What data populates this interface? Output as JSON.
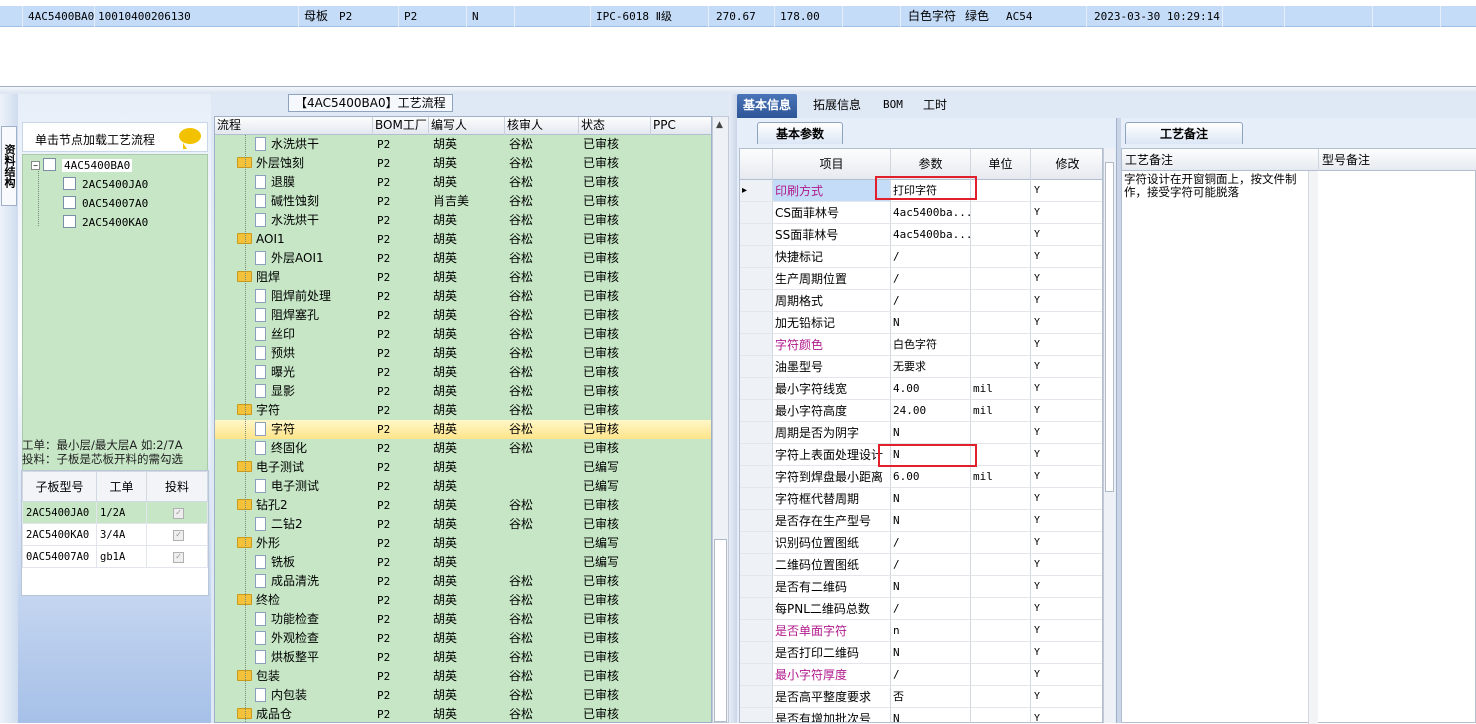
{
  "top_record": {
    "cells": [
      "4AC5400BA0",
      "10010400206130",
      "母板",
      "P2",
      "P2",
      "N",
      "IPC-6018 Ⅱ级",
      "270.67",
      "178.00",
      "白色字符",
      "绿色",
      "AC54",
      "2023-03-30 10:29:14"
    ]
  },
  "left_strip": {
    "label": "资料结构"
  },
  "left_panel": {
    "header_text": "单击节点加载工艺流程",
    "tree": {
      "root": "4AC5400BA0",
      "children": [
        "2AC5400JA0",
        "0AC54007A0",
        "2AC5400KA0"
      ]
    },
    "work_info_line1": "工单：最小层/最大层A 如:2/7A",
    "work_info_line2": "投料：子板是芯板开料的需勾选",
    "subgrid": {
      "headers": [
        "子板型号",
        "工单",
        "投料"
      ],
      "rows": [
        {
          "model": "2AC5400JA0",
          "order": "1/2A",
          "checked": "✓"
        },
        {
          "model": "2AC5400KA0",
          "order": "3/4A",
          "checked": "✓"
        },
        {
          "model": "0AC54007A0",
          "order": "gb1A",
          "checked": "✓"
        }
      ]
    }
  },
  "process_panel": {
    "title": "【4AC5400BA0】工艺流程",
    "headers": [
      "流程",
      "BOM工厂",
      "编写人",
      "核审人",
      "状态",
      "PPC"
    ],
    "rows": [
      {
        "name": "水洗烘干",
        "type": "doc",
        "factory": "P2",
        "writer": "胡英",
        "reviewer": "谷松",
        "status": "已审核"
      },
      {
        "name": "外层蚀刻",
        "type": "folder",
        "factory": "P2",
        "writer": "胡英",
        "reviewer": "谷松",
        "status": "已审核"
      },
      {
        "name": "退膜",
        "type": "doc",
        "factory": "P2",
        "writer": "胡英",
        "reviewer": "谷松",
        "status": "已审核"
      },
      {
        "name": "碱性蚀刻",
        "type": "doc",
        "factory": "P2",
        "writer": "肖吉美",
        "reviewer": "谷松",
        "status": "已审核"
      },
      {
        "name": "水洗烘干",
        "type": "doc",
        "factory": "P2",
        "writer": "胡英",
        "reviewer": "谷松",
        "status": "已审核"
      },
      {
        "name": "AOI1",
        "type": "folder",
        "factory": "P2",
        "writer": "胡英",
        "reviewer": "谷松",
        "status": "已审核"
      },
      {
        "name": "外层AOI1",
        "type": "doc",
        "factory": "P2",
        "writer": "胡英",
        "reviewer": "谷松",
        "status": "已审核"
      },
      {
        "name": "阻焊",
        "type": "folder",
        "factory": "P2",
        "writer": "胡英",
        "reviewer": "谷松",
        "status": "已审核"
      },
      {
        "name": "阻焊前处理",
        "type": "doc",
        "factory": "P2",
        "writer": "胡英",
        "reviewer": "谷松",
        "status": "已审核"
      },
      {
        "name": "阻焊塞孔",
        "type": "doc",
        "factory": "P2",
        "writer": "胡英",
        "reviewer": "谷松",
        "status": "已审核"
      },
      {
        "name": "丝印",
        "type": "doc",
        "factory": "P2",
        "writer": "胡英",
        "reviewer": "谷松",
        "status": "已审核"
      },
      {
        "name": "预烘",
        "type": "doc",
        "factory": "P2",
        "writer": "胡英",
        "reviewer": "谷松",
        "status": "已审核"
      },
      {
        "name": "曝光",
        "type": "doc",
        "factory": "P2",
        "writer": "胡英",
        "reviewer": "谷松",
        "status": "已审核"
      },
      {
        "name": "显影",
        "type": "doc",
        "factory": "P2",
        "writer": "胡英",
        "reviewer": "谷松",
        "status": "已审核"
      },
      {
        "name": "字符",
        "type": "folder",
        "factory": "P2",
        "writer": "胡英",
        "reviewer": "谷松",
        "status": "已审核"
      },
      {
        "name": "字符",
        "type": "doc",
        "factory": "P2",
        "writer": "胡英",
        "reviewer": "谷松",
        "status": "已审核",
        "selected": true
      },
      {
        "name": "终固化",
        "type": "doc",
        "factory": "P2",
        "writer": "胡英",
        "reviewer": "谷松",
        "status": "已审核"
      },
      {
        "name": "电子测试",
        "type": "folder",
        "factory": "P2",
        "writer": "胡英",
        "reviewer": "",
        "status": "已编写"
      },
      {
        "name": "电子测试",
        "type": "doc",
        "factory": "P2",
        "writer": "胡英",
        "reviewer": "",
        "status": "已编写"
      },
      {
        "name": "钻孔2",
        "type": "folder",
        "factory": "P2",
        "writer": "胡英",
        "reviewer": "谷松",
        "status": "已审核"
      },
      {
        "name": "二钻2",
        "type": "doc",
        "factory": "P2",
        "writer": "胡英",
        "reviewer": "谷松",
        "status": "已审核"
      },
      {
        "name": "外形",
        "type": "folder",
        "factory": "P2",
        "writer": "胡英",
        "reviewer": "",
        "status": "已编写"
      },
      {
        "name": "铣板",
        "type": "doc",
        "factory": "P2",
        "writer": "胡英",
        "reviewer": "",
        "status": "已编写"
      },
      {
        "name": "成品清洗",
        "type": "doc",
        "factory": "P2",
        "writer": "胡英",
        "reviewer": "谷松",
        "status": "已审核"
      },
      {
        "name": "终检",
        "type": "folder",
        "factory": "P2",
        "writer": "胡英",
        "reviewer": "谷松",
        "status": "已审核"
      },
      {
        "name": "功能检查",
        "type": "doc",
        "factory": "P2",
        "writer": "胡英",
        "reviewer": "谷松",
        "status": "已审核"
      },
      {
        "name": "外观检查",
        "type": "doc",
        "factory": "P2",
        "writer": "胡英",
        "reviewer": "谷松",
        "status": "已审核"
      },
      {
        "name": "烘板整平",
        "type": "doc",
        "factory": "P2",
        "writer": "胡英",
        "reviewer": "谷松",
        "status": "已审核"
      },
      {
        "name": "包装",
        "type": "folder",
        "factory": "P2",
        "writer": "胡英",
        "reviewer": "谷松",
        "status": "已审核"
      },
      {
        "name": "内包装",
        "type": "doc",
        "factory": "P2",
        "writer": "胡英",
        "reviewer": "谷松",
        "status": "已审核"
      },
      {
        "name": "成品仓",
        "type": "folder",
        "factory": "P2",
        "writer": "胡英",
        "reviewer": "谷松",
        "status": "已审核"
      }
    ]
  },
  "tabs": [
    "基本信息",
    "拓展信息",
    "BOM",
    "工时"
  ],
  "basic_panel": {
    "subtab": "基本参数",
    "headers": [
      "项目",
      "参数",
      "单位",
      "修改"
    ],
    "rows": [
      {
        "item": "印刷方式",
        "value": "打印字符",
        "unit": "",
        "mod": "Y",
        "style": "purple",
        "current": true
      },
      {
        "item": "CS面菲林号",
        "value": "4ac5400ba...",
        "unit": "",
        "mod": "Y"
      },
      {
        "item": "SS面菲林号",
        "value": "4ac5400ba...",
        "unit": "",
        "mod": "Y"
      },
      {
        "item": "快捷标记",
        "value": "/",
        "unit": "",
        "mod": "Y"
      },
      {
        "item": "生产周期位置",
        "value": "/",
        "unit": "",
        "mod": "Y"
      },
      {
        "item": "周期格式",
        "value": "/",
        "unit": "",
        "mod": "Y"
      },
      {
        "item": "加无铅标记",
        "value": "N",
        "unit": "",
        "mod": "Y"
      },
      {
        "item": "字符颜色",
        "value": "白色字符",
        "unit": "",
        "mod": "Y",
        "style": "purple"
      },
      {
        "item": "油墨型号",
        "value": "无要求",
        "unit": "",
        "mod": "Y"
      },
      {
        "item": "最小字符线宽",
        "value": "4.00",
        "unit": "mil",
        "mod": "Y"
      },
      {
        "item": "最小字符高度",
        "value": "24.00",
        "unit": "mil",
        "mod": "Y"
      },
      {
        "item": "周期是否为阴字",
        "value": "N",
        "unit": "",
        "mod": "Y"
      },
      {
        "item": "字符上表面处理设计",
        "value": "N",
        "unit": "",
        "mod": "Y"
      },
      {
        "item": "字符到焊盘最小距离",
        "value": "6.00",
        "unit": "mil",
        "mod": "Y"
      },
      {
        "item": "字符框代替周期",
        "value": "N",
        "unit": "",
        "mod": "Y"
      },
      {
        "item": "是否存在生产型号",
        "value": "N",
        "unit": "",
        "mod": "Y"
      },
      {
        "item": "识别码位置图纸",
        "value": "/",
        "unit": "",
        "mod": "Y"
      },
      {
        "item": "二维码位置图纸",
        "value": "/",
        "unit": "",
        "mod": "Y"
      },
      {
        "item": "是否有二维码",
        "value": "N",
        "unit": "",
        "mod": "Y"
      },
      {
        "item": "每PNL二维码总数",
        "value": "/",
        "unit": "",
        "mod": "Y"
      },
      {
        "item": "是否单面字符",
        "value": "n",
        "unit": "",
        "mod": "Y",
        "style": "purple"
      },
      {
        "item": "是否打印二维码",
        "value": "N",
        "unit": "",
        "mod": "Y"
      },
      {
        "item": "最小字符厚度",
        "value": "/",
        "unit": "",
        "mod": "Y",
        "style": "purple"
      },
      {
        "item": "是否高平整度要求",
        "value": "否",
        "unit": "",
        "mod": "Y"
      },
      {
        "item": "是否有增加批次号",
        "value": "N",
        "unit": "",
        "mod": "Y"
      }
    ]
  },
  "notes_panel": {
    "subtab": "工艺备注",
    "headers": [
      "工艺备注",
      "型号备注"
    ],
    "note_text": "字符设计在开窗铜面上，按文件制作，接受字符可能脱落"
  }
}
